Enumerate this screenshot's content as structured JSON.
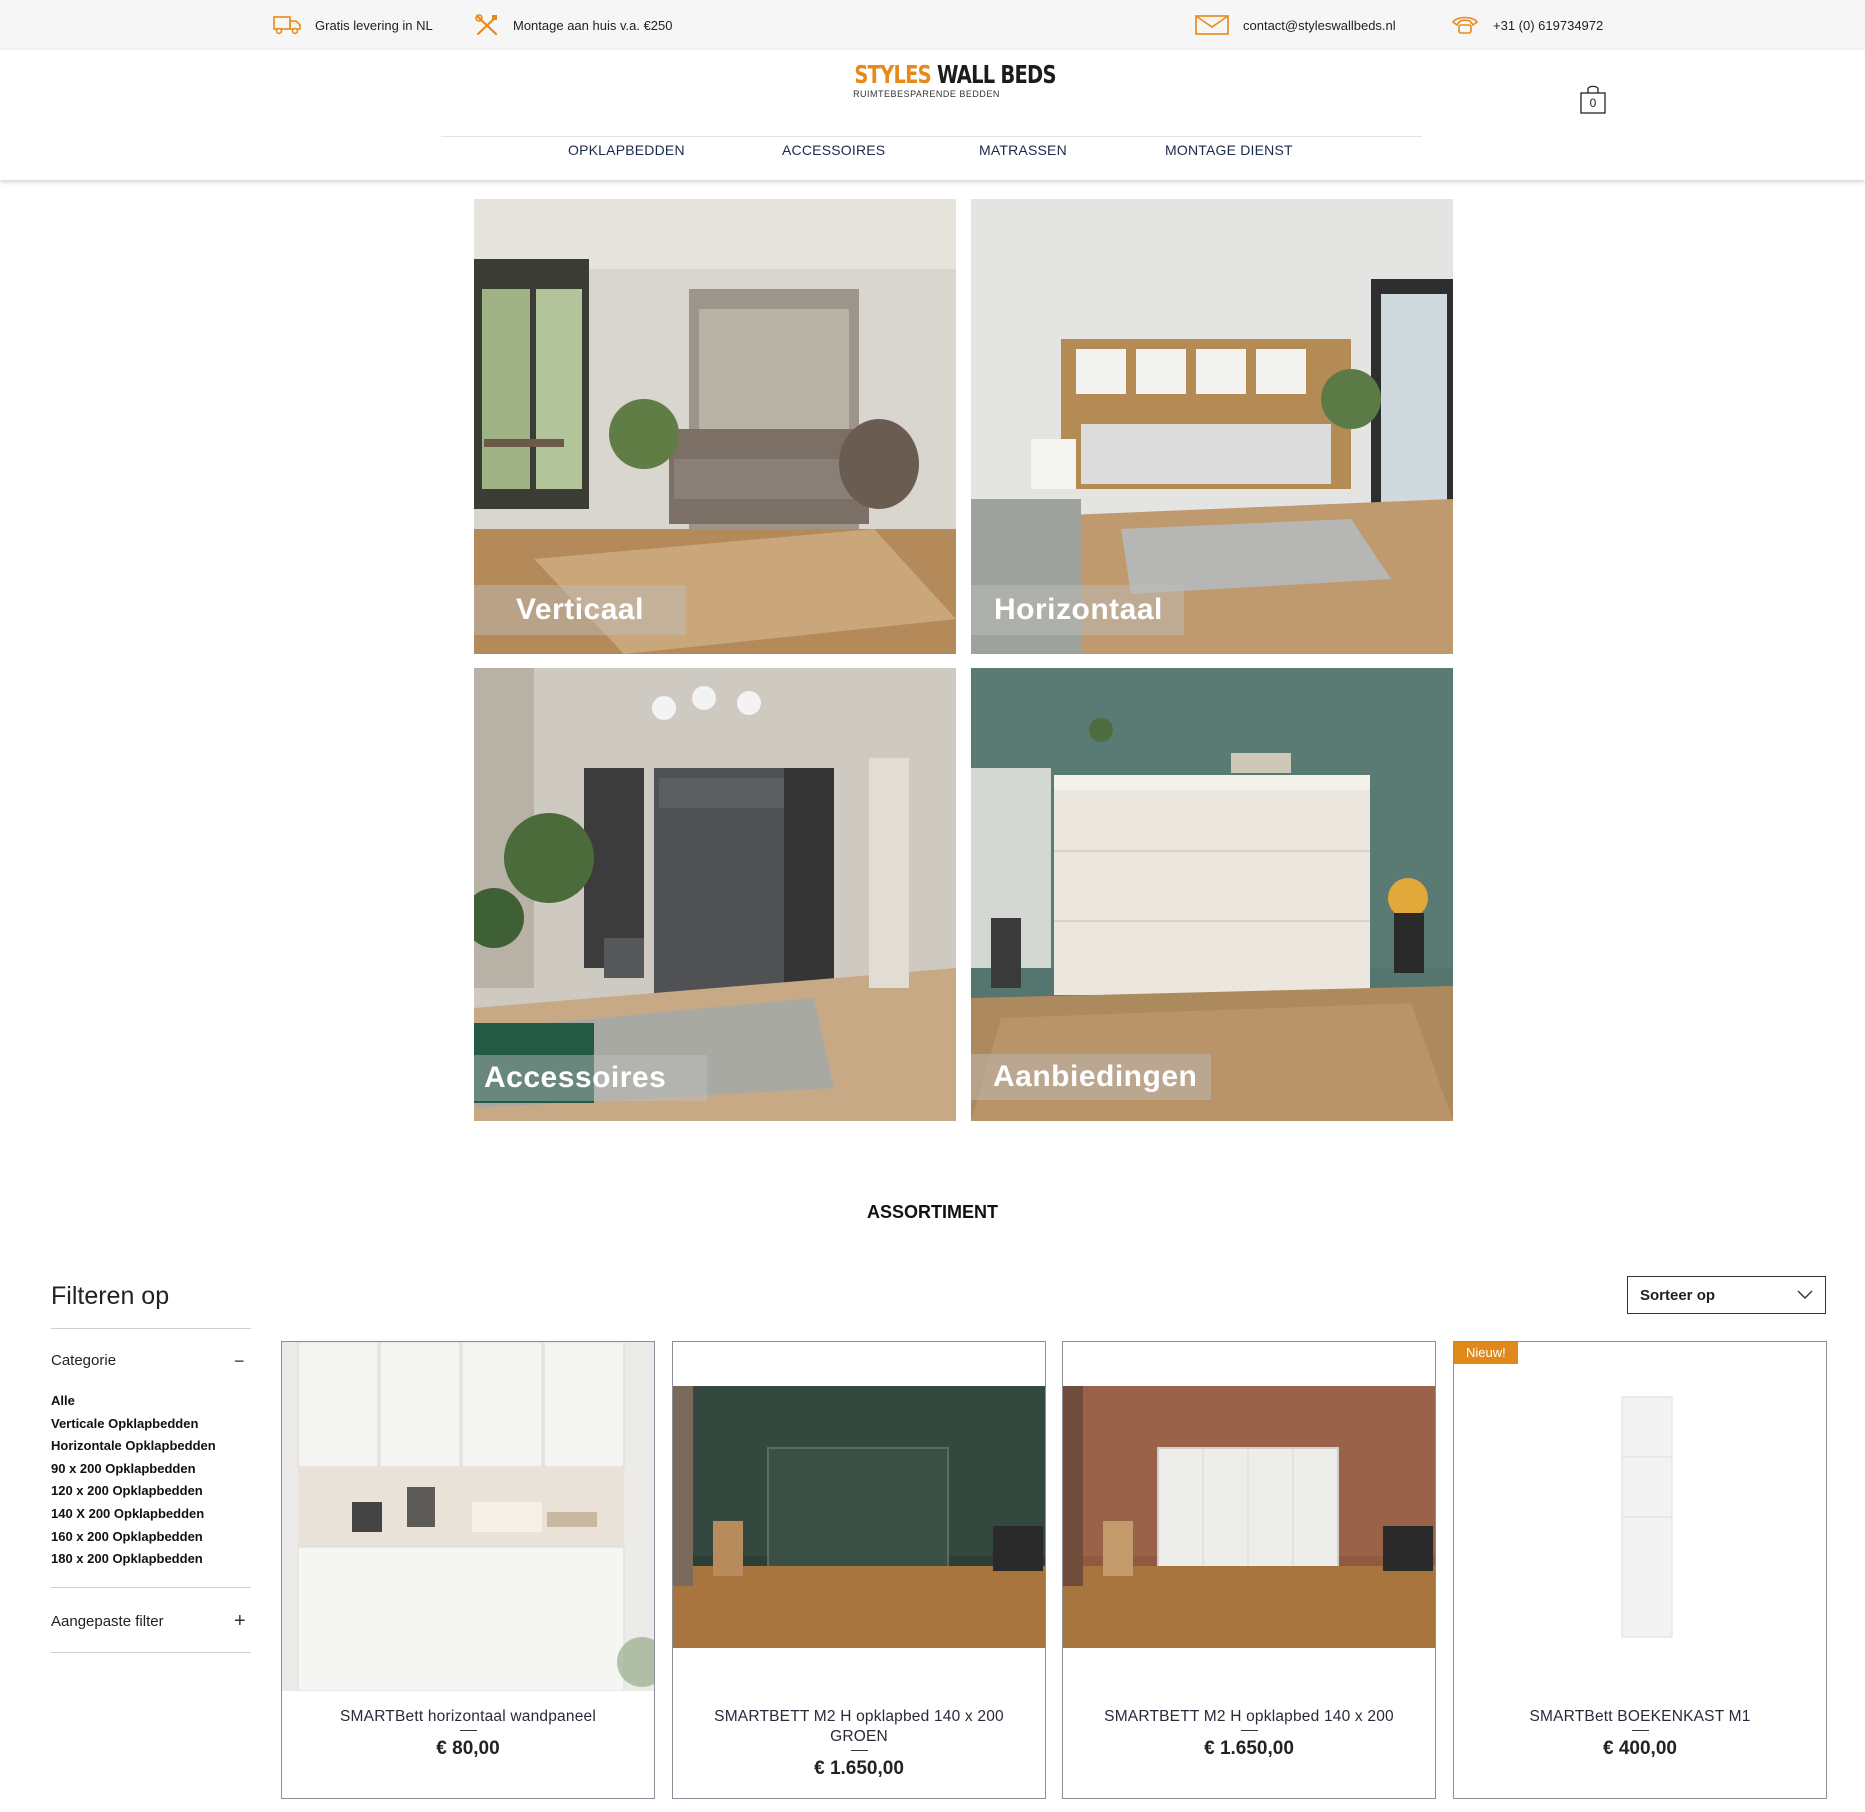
{
  "topbar": {
    "delivery": "Gratis levering in NL",
    "assembly": "Montage aan huis v.a. €250",
    "email": "contact@styleswallbeds.nl",
    "phone": "+31 (0) 619734972"
  },
  "logo": {
    "word1": "STYLES",
    "word2": "WALL BEDS",
    "tagline": "RUIMTEBESPARENDE BEDDEN"
  },
  "cart": {
    "count": "0"
  },
  "nav": [
    "OPKLAPBEDDEN",
    "ACCESSOIRES",
    "MATRASSEN",
    "MONTAGE DIENST"
  ],
  "tiles": [
    "Verticaal",
    "Horizontaal",
    "Accessoires",
    "Aanbiedingen"
  ],
  "section_title": "ASSORTIMENT",
  "filter": {
    "title": "Filteren op",
    "category_label": "Categorie",
    "category_toggle": "−",
    "categories": [
      "Alle",
      "Verticale Opklapbedden",
      "Horizontale Opklapbedden",
      "90 x 200 Opklapbedden",
      "120 x 200 Opklapbedden",
      "140 X 200 Opklapbedden",
      "160 x 200 Opklapbedden",
      "180 x 200 Opklapbedden"
    ],
    "custom_label": "Aangepaste filter",
    "custom_toggle": "+"
  },
  "sort": {
    "label": "Sorteer op"
  },
  "products": [
    {
      "name": "SMARTBett horizontaal wandpaneel",
      "price": "€ 80,00",
      "badge": ""
    },
    {
      "name": "SMARTBETT M2 H opklapbed 140 x 200 GROEN",
      "price": "€ 1.650,00",
      "badge": ""
    },
    {
      "name": "SMARTBETT M2 H opklapbed 140 x 200",
      "price": "€ 1.650,00",
      "badge": ""
    },
    {
      "name": "SMARTBett BOEKENKAST M1",
      "price": "€ 400,00",
      "badge": "Nieuw!"
    }
  ],
  "colors": {
    "accent": "#e8891a",
    "nav": "#1b2a4a"
  }
}
